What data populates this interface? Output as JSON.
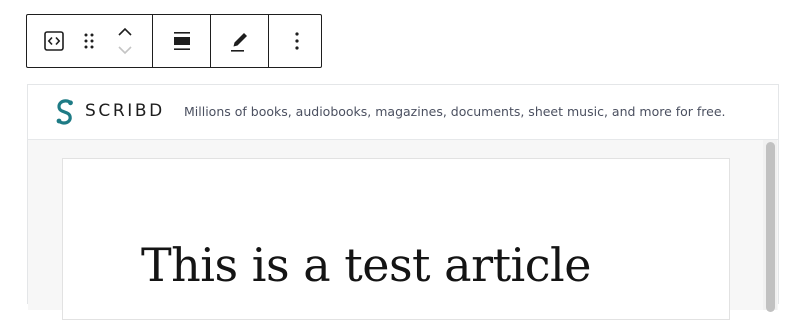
{
  "toolbar": {
    "buttons": [
      {
        "name": "embed-block-icon",
        "label": "Embed"
      },
      {
        "name": "drag-handle-icon",
        "label": "Drag"
      },
      {
        "name": "move-up-icon",
        "label": "Move up"
      },
      {
        "name": "move-down-icon",
        "label": "Move down"
      },
      {
        "name": "align-icon",
        "label": "Align"
      },
      {
        "name": "edit-pencil-icon",
        "label": "Edit URL"
      },
      {
        "name": "more-options-icon",
        "label": "Options"
      }
    ]
  },
  "scribd": {
    "brand": "SCRIBD",
    "tagline": "Millions of books, audiobooks, magazines, documents, sheet music, and more for free.",
    "brand_color": "#1e7b85"
  },
  "document": {
    "title": "This is a test article"
  }
}
